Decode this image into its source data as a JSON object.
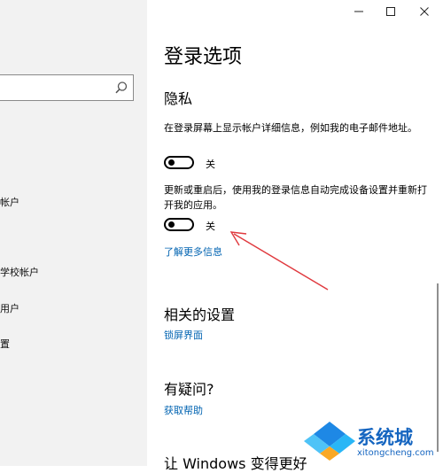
{
  "window": {
    "minimize_icon": "minimize-icon",
    "maximize_icon": "maximize-icon",
    "close_icon": "close-icon"
  },
  "sidebar": {
    "search": {
      "placeholder": "",
      "icon": "search-icon"
    },
    "items": [
      {
        "label": "帐户"
      },
      {
        "label": "学校帐户"
      },
      {
        "label": "用户"
      },
      {
        "label": "置"
      }
    ]
  },
  "page": {
    "title": "登录选项",
    "privacy": {
      "heading": "隐私",
      "setting1": {
        "description": "在登录屏幕上显示帐户详细信息，例如我的电子邮件地址。",
        "state": "关"
      },
      "setting2": {
        "description": "更新或重启后，使用我的登录信息自动完成设备设置并重新打开我的应用。",
        "state": "关"
      },
      "learn_more": "了解更多信息"
    },
    "related": {
      "heading": "相关的设置",
      "link": "锁屏界面"
    },
    "questions": {
      "heading": "有疑问?",
      "link": "获取帮助"
    },
    "improve": {
      "heading": "让 Windows 变得更好"
    }
  },
  "watermark": {
    "text": "系统城",
    "url_text": "xitongcheng.com"
  },
  "colors": {
    "link": "#0063b1",
    "annotation_arrow": "#e0393e",
    "sidebar_bg": "#f2f2f2"
  }
}
